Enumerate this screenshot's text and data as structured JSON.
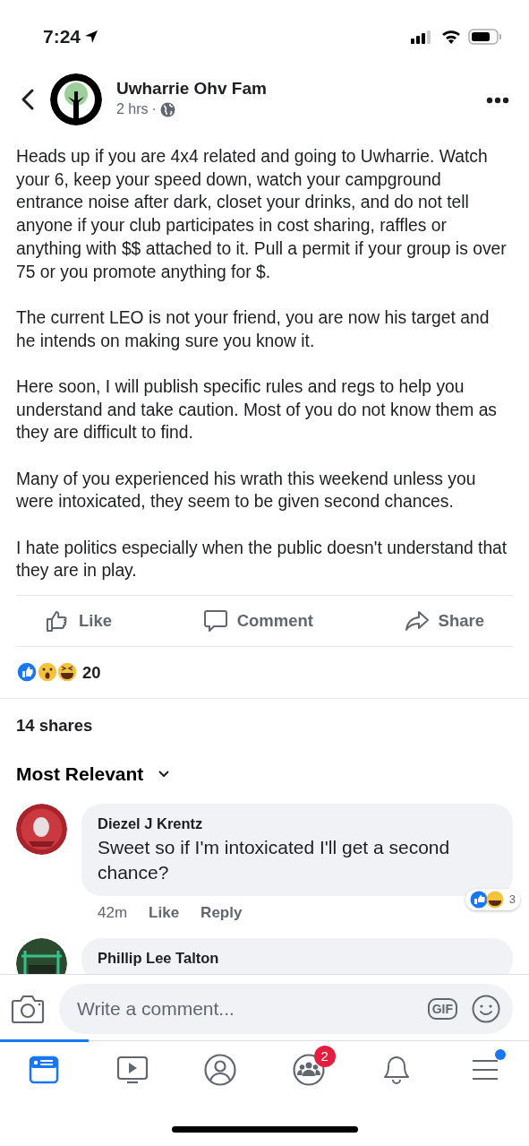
{
  "status_bar": {
    "time": "7:24"
  },
  "post": {
    "author": "Uwharrie Ohv Fam",
    "time": "2 hrs",
    "separator": "·",
    "paragraphs": [
      "Heads up if you are 4x4 related and going to Uwharrie. Watch your 6, keep your speed down, watch your campground entrance noise after dark, closet your drinks, and do not tell anyone if your club participates in cost sharing, raffles or anything with $$ attached to it. Pull a permit if your group is over 75 or you promote anything for $.",
      "The current LEO is not your friend, you are now his target and he intends on making sure you know it.",
      "Here soon, I will publish specific rules and regs to help you understand and take caution. Most of you do not know them as they are difficult to find.",
      "Many of you experienced his wrath this weekend unless you were intoxicated, they seem to be given second chances.",
      "I hate politics especially when the public doesn't understand that they are in play."
    ],
    "actions": [
      {
        "kind": "like",
        "label": "Like"
      },
      {
        "kind": "comment",
        "label": "Comment"
      },
      {
        "kind": "share",
        "label": "Share"
      }
    ],
    "reaction_count": "20",
    "shares": "14 shares"
  },
  "sort": {
    "label": "Most Relevant"
  },
  "comments": [
    {
      "author": "Diezel J Krentz",
      "text": "Sweet so if I'm intoxicated I'll get a second chance?",
      "time": "42m",
      "like": "Like",
      "reply": "Reply",
      "reaction_count": "3"
    },
    {
      "author": "Phillip Lee Talton"
    }
  ],
  "composer": {
    "placeholder": "Write a comment...",
    "gif": "GIF"
  },
  "tabs": [
    {
      "kind": "feed",
      "selected": true
    },
    {
      "kind": "watch",
      "selected": false
    },
    {
      "kind": "profile",
      "selected": false
    },
    {
      "kind": "groups",
      "selected": false,
      "badge": "2"
    },
    {
      "kind": "notifications",
      "selected": false
    },
    {
      "kind": "menu",
      "selected": false,
      "dot": true
    }
  ]
}
